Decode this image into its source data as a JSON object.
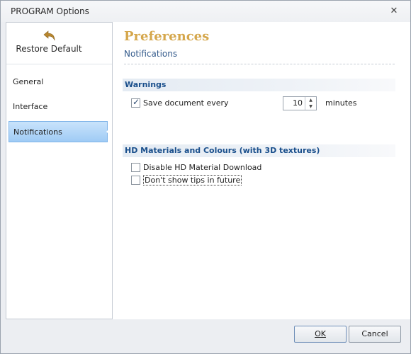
{
  "window": {
    "title": "PROGRAM Options",
    "close_glyph": "✕"
  },
  "sidebar": {
    "restore_label": "Restore Default",
    "items": [
      {
        "label": "General",
        "active": false
      },
      {
        "label": "Interface",
        "active": false
      },
      {
        "label": "Notifications",
        "active": true
      }
    ]
  },
  "content": {
    "title": "Preferences",
    "subtitle": "Notifications",
    "warnings": {
      "heading": "Warnings",
      "save_label": "Save document every",
      "save_checked": true,
      "interval_value": "10",
      "interval_unit": "minutes"
    },
    "hd": {
      "heading": "HD Materials and Colours (with 3D textures)",
      "disable_label": "Disable HD Material Download",
      "disable_checked": false,
      "tips_label": "Don't show tips in future",
      "tips_checked": false
    }
  },
  "footer": {
    "ok_label": "OK",
    "cancel_label": "Cancel"
  },
  "colors": {
    "accent": "#d5a74c",
    "section_text": "#1a4f8c",
    "nav_active": "#9fcbf5"
  },
  "icons": {
    "restore": "undo-arrow-icon",
    "close": "close-icon",
    "spin_up": "spin-up-icon",
    "spin_down": "spin-down-icon"
  }
}
